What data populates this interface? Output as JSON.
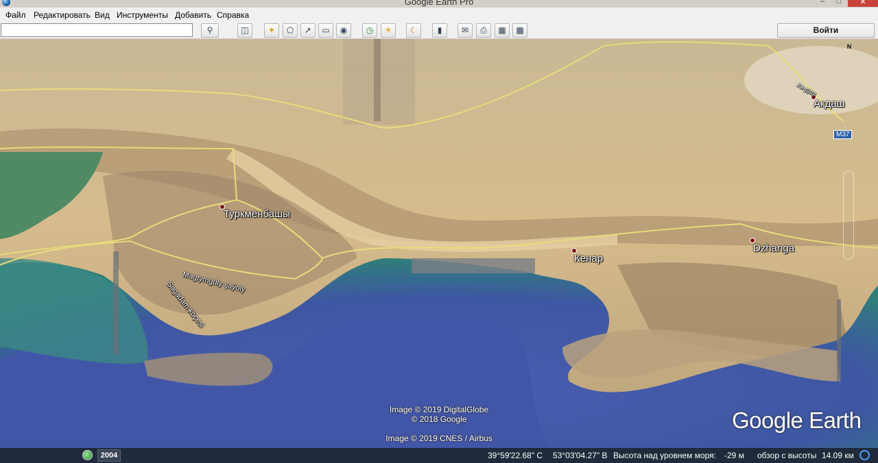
{
  "window": {
    "title": "Google Earth Pro",
    "minimize": "–",
    "maximize": "□",
    "close": "✕"
  },
  "menu": [
    "Файл",
    "Редактировать",
    "Вид",
    "Инструменты",
    "Добавить",
    "Справка"
  ],
  "search": {
    "value": "",
    "placeholder": ""
  },
  "toolbar": {
    "signin_label": "Войти",
    "buttons": [
      "search-icon",
      "sidebar-icon",
      "placemark-icon",
      "polygon-icon",
      "path-icon",
      "image-overlay-icon",
      "record-tour-icon",
      "historical-imagery-icon",
      "sunlight-icon",
      "planets-icon",
      "ruler-icon",
      "email-icon",
      "print-icon",
      "save-image-icon",
      "view-in-maps-icon"
    ]
  },
  "map": {
    "places": {
      "turkmenbashi": "Туркменбашы",
      "kenar": "Кенар",
      "dzhanga": "Dzhanga",
      "akdash": "Акдаш"
    },
    "streets": {
      "magtymguly": "Magtymguly şaýoly",
      "sagadam": "Sagadam köçesi",
      "akdash_road": "Ак-даш"
    },
    "road_shield": "M37",
    "north": "N",
    "credits": {
      "digitalglobe": "Image © 2019 DigitalGlobe",
      "google": "© 2018 Google",
      "cnes": "Image © 2019 CNES / Airbus"
    },
    "logo": "Google Earth",
    "colors": {
      "sea": "#3f56a0",
      "shallow": "#3f8f84",
      "land": "#d4b98a",
      "road": "#e6dc7a"
    }
  },
  "status": {
    "year": "2004",
    "lat": "39°59'22.68\" С",
    "lon": "53°03'04.27\" В",
    "elev_label": "Высота над уровнем моря:",
    "elev_value": "-29 м",
    "eye_label": "обзор с высоты",
    "eye_value": "14.09 км"
  }
}
